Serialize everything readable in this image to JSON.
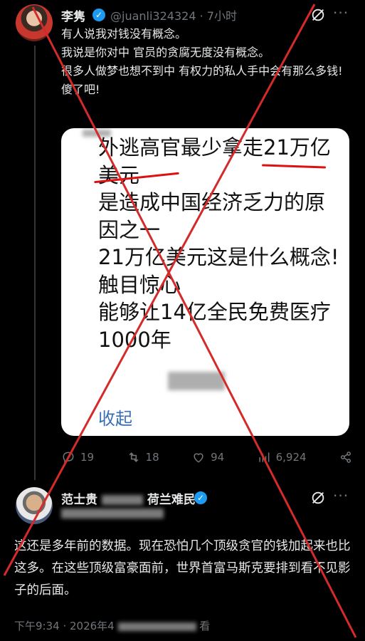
{
  "tweet": {
    "author": "李隽",
    "handle": "@juanli324324",
    "time": "· 7小时",
    "text": "有人说我对钱没有概念。\n我说是你对中 官员的贪腐无度没有概念。\n很多人做梦也想不到中 有权力的私人手中会有那么多钱!\n傻了吧!",
    "card": {
      "text": "外逃高官最少拿走21万亿美元\n是造成中国经济乏力的原因之一\n21万亿美元这是什么概念!触目惊心\n能够让14亿全民免费医疗1000年",
      "collapse_label": "收起"
    },
    "stats": {
      "replies": "19",
      "retweets": "18",
      "likes": "94",
      "views": "6,924"
    }
  },
  "reply": {
    "author": "范士贵",
    "author_suffix": "荷兰难民",
    "text": "这还是多年前的数据。现在恐怕几个顶级贪官的钱加起来也比这多。在这些顶级富豪面前，世界首富马斯克要排到看不见影子的后面。",
    "timestamp": "下午9:34 · 2026年4",
    "views_suffix": "看"
  },
  "colors": {
    "background": "#000000",
    "text": "#e7e9ea",
    "muted": "#71767b",
    "verified": "#1d9bf0",
    "cross": "#d42a2a",
    "card_link": "#3a6fb5"
  }
}
